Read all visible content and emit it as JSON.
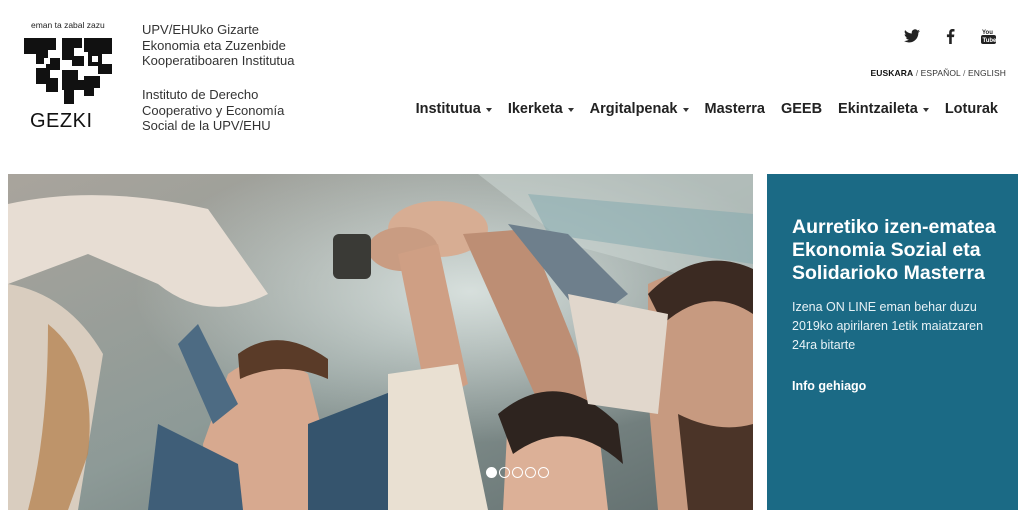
{
  "logo": {
    "motto": "eman ta zabal zazu",
    "wordmark": "GEZKI"
  },
  "institute": {
    "name_eu": [
      "UPV/EHUko Gizarte",
      "Ekonomia eta Zuzenbide",
      "Kooperatiboaren Institutua"
    ],
    "name_es": [
      "Instituto de Derecho",
      "Cooperativo y Economía",
      "Social de la UPV/EHU"
    ]
  },
  "social": [
    {
      "icon": "twitter-icon"
    },
    {
      "icon": "facebook-icon"
    },
    {
      "icon": "youtube-icon"
    }
  ],
  "languages": {
    "items": [
      "EUSKARA",
      "ESPAÑOL",
      "ENGLISH"
    ],
    "separator": " / ",
    "active": "EUSKARA"
  },
  "nav": [
    {
      "label": "Institutua",
      "dropdown": true
    },
    {
      "label": "Ikerketa",
      "dropdown": true
    },
    {
      "label": "Argitalpenak",
      "dropdown": true
    },
    {
      "label": "Masterra",
      "dropdown": false
    },
    {
      "label": "GEEB",
      "dropdown": false
    },
    {
      "label": "Ekintzaileta",
      "dropdown": true
    },
    {
      "label": "Loturak",
      "dropdown": false
    }
  ],
  "carousel": {
    "slide_count": 5,
    "active_index": 0
  },
  "promo": {
    "title": "Aurretiko izen-ematea Ekonomia Sozial eta Solidarioko Masterra",
    "body": "Izena ON LINE eman behar duzu 2019ko apirilaren 1etik maiatzaren 24ra bitarte",
    "link": "Info gehiago"
  },
  "colors": {
    "promo_bg": "#1b6a85",
    "nav_text": "#222222"
  }
}
